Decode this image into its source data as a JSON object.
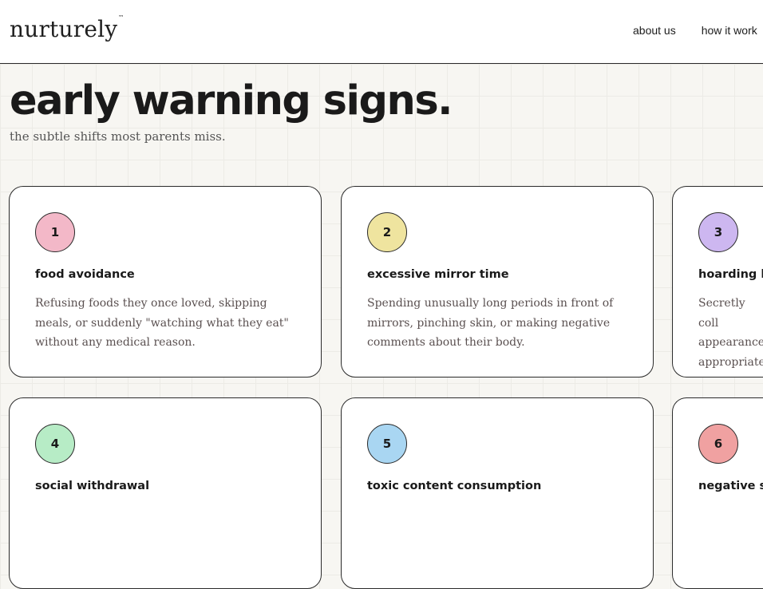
{
  "header": {
    "logo": "nurturely",
    "logo_mark": "™",
    "nav": [
      "about us",
      "how it work"
    ]
  },
  "hero": {
    "title": "early warning signs.",
    "subtitle": "the subtle shifts most parents miss."
  },
  "cards": [
    {
      "number": "1",
      "title": "food avoidance",
      "desc": "Refusing foods they once loved, skipping meals, or suddenly \"watching what they eat\" without any medical reason.",
      "color": "#f3b8c8"
    },
    {
      "number": "2",
      "title": "excessive mirror time",
      "desc": "Spending unusually long periods in front of mirrors, pinching skin, or making negative comments about their body.",
      "color": "#efe49f"
    },
    {
      "number": "3",
      "title": "hoarding b",
      "desc": "Secretly coll appearance appropriate",
      "color": "#cdb7f0"
    },
    {
      "number": "4",
      "title": "social withdrawal",
      "desc": "",
      "color": "#b7ecc6"
    },
    {
      "number": "5",
      "title": "toxic content consumption",
      "desc": "",
      "color": "#a9d6f2"
    },
    {
      "number": "6",
      "title": "negative s",
      "desc": "",
      "color": "#f0a1a1"
    }
  ]
}
